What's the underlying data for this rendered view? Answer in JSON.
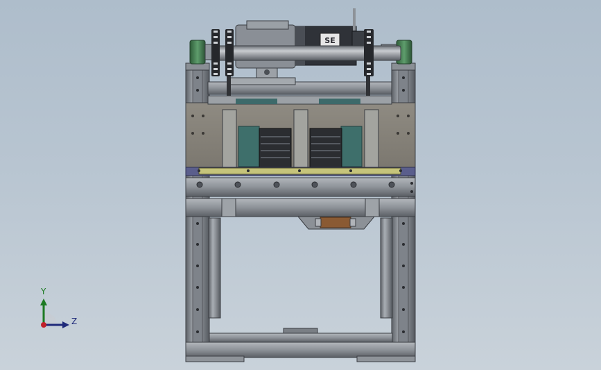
{
  "viewport": {
    "background_top": "#aebdcb",
    "background_bottom": "#c9d2da"
  },
  "model": {
    "motor_badge": "SE"
  },
  "triad": {
    "y_label": "Y",
    "z_label": "Z",
    "y_color": "#1d7a23",
    "z_color": "#1f2a7a",
    "origin_color": "#c0202a"
  }
}
